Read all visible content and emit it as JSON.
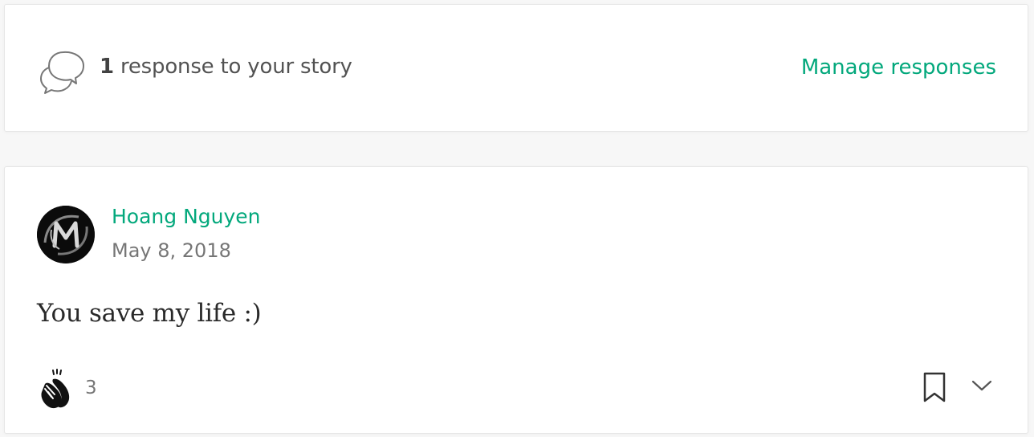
{
  "header": {
    "response_count": "1",
    "response_text": " response to your story",
    "manage_label": "Manage responses",
    "icon": "speech-bubbles-icon"
  },
  "response": {
    "author": "Hoang Nguyen",
    "date": "May 8, 2018",
    "text": "You save my life :)",
    "clap_count": "3",
    "avatar_icon": "avatar-monogram"
  },
  "actions": {
    "clap_icon": "clap-icon",
    "bookmark_icon": "bookmark-icon",
    "more_icon": "chevron-down-icon"
  },
  "colors": {
    "accent": "#03a87c",
    "background": "#f7f7f7",
    "card": "#ffffff"
  }
}
